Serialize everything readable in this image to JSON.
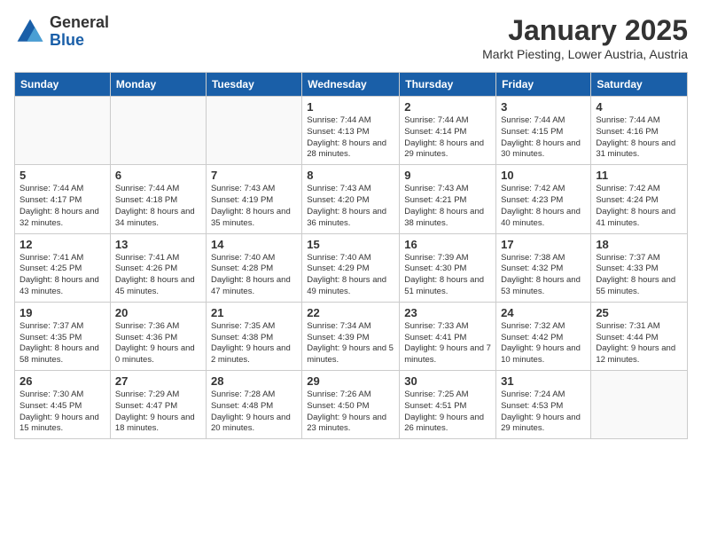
{
  "logo": {
    "general": "General",
    "blue": "Blue"
  },
  "header": {
    "month": "January 2025",
    "location": "Markt Piesting, Lower Austria, Austria"
  },
  "weekdays": [
    "Sunday",
    "Monday",
    "Tuesday",
    "Wednesday",
    "Thursday",
    "Friday",
    "Saturday"
  ],
  "weeks": [
    [
      {
        "day": "",
        "info": ""
      },
      {
        "day": "",
        "info": ""
      },
      {
        "day": "",
        "info": ""
      },
      {
        "day": "1",
        "info": "Sunrise: 7:44 AM\nSunset: 4:13 PM\nDaylight: 8 hours and 28 minutes."
      },
      {
        "day": "2",
        "info": "Sunrise: 7:44 AM\nSunset: 4:14 PM\nDaylight: 8 hours and 29 minutes."
      },
      {
        "day": "3",
        "info": "Sunrise: 7:44 AM\nSunset: 4:15 PM\nDaylight: 8 hours and 30 minutes."
      },
      {
        "day": "4",
        "info": "Sunrise: 7:44 AM\nSunset: 4:16 PM\nDaylight: 8 hours and 31 minutes."
      }
    ],
    [
      {
        "day": "5",
        "info": "Sunrise: 7:44 AM\nSunset: 4:17 PM\nDaylight: 8 hours and 32 minutes."
      },
      {
        "day": "6",
        "info": "Sunrise: 7:44 AM\nSunset: 4:18 PM\nDaylight: 8 hours and 34 minutes."
      },
      {
        "day": "7",
        "info": "Sunrise: 7:43 AM\nSunset: 4:19 PM\nDaylight: 8 hours and 35 minutes."
      },
      {
        "day": "8",
        "info": "Sunrise: 7:43 AM\nSunset: 4:20 PM\nDaylight: 8 hours and 36 minutes."
      },
      {
        "day": "9",
        "info": "Sunrise: 7:43 AM\nSunset: 4:21 PM\nDaylight: 8 hours and 38 minutes."
      },
      {
        "day": "10",
        "info": "Sunrise: 7:42 AM\nSunset: 4:23 PM\nDaylight: 8 hours and 40 minutes."
      },
      {
        "day": "11",
        "info": "Sunrise: 7:42 AM\nSunset: 4:24 PM\nDaylight: 8 hours and 41 minutes."
      }
    ],
    [
      {
        "day": "12",
        "info": "Sunrise: 7:41 AM\nSunset: 4:25 PM\nDaylight: 8 hours and 43 minutes."
      },
      {
        "day": "13",
        "info": "Sunrise: 7:41 AM\nSunset: 4:26 PM\nDaylight: 8 hours and 45 minutes."
      },
      {
        "day": "14",
        "info": "Sunrise: 7:40 AM\nSunset: 4:28 PM\nDaylight: 8 hours and 47 minutes."
      },
      {
        "day": "15",
        "info": "Sunrise: 7:40 AM\nSunset: 4:29 PM\nDaylight: 8 hours and 49 minutes."
      },
      {
        "day": "16",
        "info": "Sunrise: 7:39 AM\nSunset: 4:30 PM\nDaylight: 8 hours and 51 minutes."
      },
      {
        "day": "17",
        "info": "Sunrise: 7:38 AM\nSunset: 4:32 PM\nDaylight: 8 hours and 53 minutes."
      },
      {
        "day": "18",
        "info": "Sunrise: 7:37 AM\nSunset: 4:33 PM\nDaylight: 8 hours and 55 minutes."
      }
    ],
    [
      {
        "day": "19",
        "info": "Sunrise: 7:37 AM\nSunset: 4:35 PM\nDaylight: 8 hours and 58 minutes."
      },
      {
        "day": "20",
        "info": "Sunrise: 7:36 AM\nSunset: 4:36 PM\nDaylight: 9 hours and 0 minutes."
      },
      {
        "day": "21",
        "info": "Sunrise: 7:35 AM\nSunset: 4:38 PM\nDaylight: 9 hours and 2 minutes."
      },
      {
        "day": "22",
        "info": "Sunrise: 7:34 AM\nSunset: 4:39 PM\nDaylight: 9 hours and 5 minutes."
      },
      {
        "day": "23",
        "info": "Sunrise: 7:33 AM\nSunset: 4:41 PM\nDaylight: 9 hours and 7 minutes."
      },
      {
        "day": "24",
        "info": "Sunrise: 7:32 AM\nSunset: 4:42 PM\nDaylight: 9 hours and 10 minutes."
      },
      {
        "day": "25",
        "info": "Sunrise: 7:31 AM\nSunset: 4:44 PM\nDaylight: 9 hours and 12 minutes."
      }
    ],
    [
      {
        "day": "26",
        "info": "Sunrise: 7:30 AM\nSunset: 4:45 PM\nDaylight: 9 hours and 15 minutes."
      },
      {
        "day": "27",
        "info": "Sunrise: 7:29 AM\nSunset: 4:47 PM\nDaylight: 9 hours and 18 minutes."
      },
      {
        "day": "28",
        "info": "Sunrise: 7:28 AM\nSunset: 4:48 PM\nDaylight: 9 hours and 20 minutes."
      },
      {
        "day": "29",
        "info": "Sunrise: 7:26 AM\nSunset: 4:50 PM\nDaylight: 9 hours and 23 minutes."
      },
      {
        "day": "30",
        "info": "Sunrise: 7:25 AM\nSunset: 4:51 PM\nDaylight: 9 hours and 26 minutes."
      },
      {
        "day": "31",
        "info": "Sunrise: 7:24 AM\nSunset: 4:53 PM\nDaylight: 9 hours and 29 minutes."
      },
      {
        "day": "",
        "info": ""
      }
    ]
  ]
}
